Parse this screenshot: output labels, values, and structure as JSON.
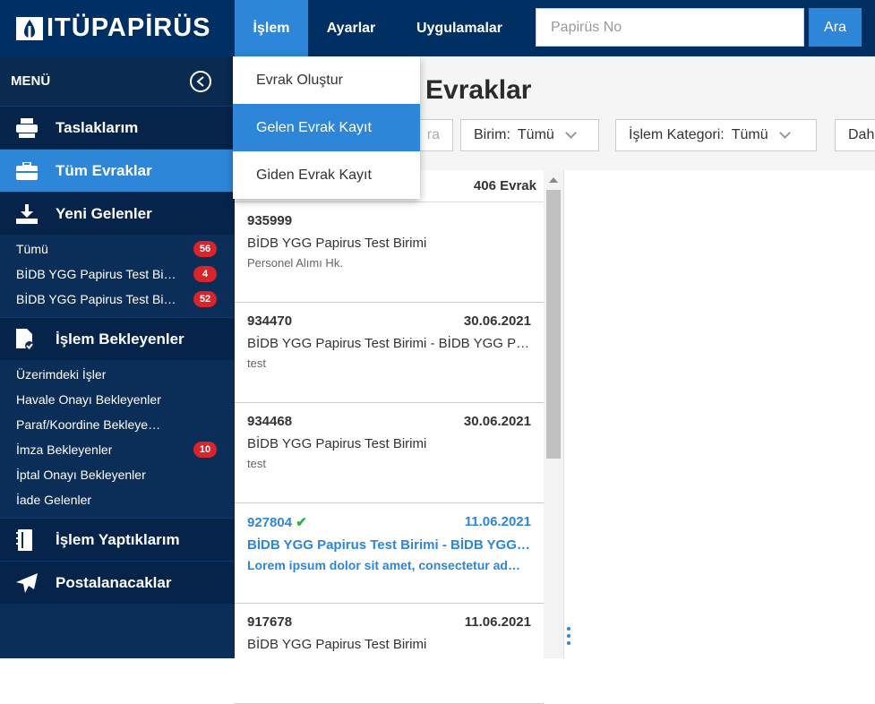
{
  "header": {
    "logo_text": "ITÜPAPİRÜS",
    "nav": [
      {
        "label": "İşlem",
        "active": true
      },
      {
        "label": "Ayarlar",
        "active": false
      },
      {
        "label": "Uygulamalar",
        "active": false
      }
    ],
    "search_placeholder": "Papirüs No",
    "search_button": "Ara"
  },
  "sidebar": {
    "menu_label": "MENÜ",
    "sections": [
      {
        "label": "Taslaklarım",
        "icon": "printer-icon"
      },
      {
        "label": "Tüm Evraklar",
        "icon": "briefcase-icon",
        "active": true
      },
      {
        "label": "Yeni Gelenler",
        "icon": "download-icon"
      },
      {
        "label": "İşlem Bekleyenler",
        "icon": "document-check-icon"
      },
      {
        "label": "İşlem Yaptıklarım",
        "icon": "notebook-icon"
      },
      {
        "label": "Postalanacaklar",
        "icon": "paper-plane-icon"
      }
    ],
    "yeni_gelenler_items": [
      {
        "label": "Tümü",
        "badge": "56"
      },
      {
        "label": "BİDB YGG Papirus Test Bi…",
        "badge": "4"
      },
      {
        "label": "BİDB YGG Papirus Test Bi…",
        "badge": "52"
      }
    ],
    "islem_bekleyenler_items": [
      {
        "label": "Üzerimdeki İşler",
        "badge": ""
      },
      {
        "label": "Havale Onayı Bekleyenler",
        "badge": ""
      },
      {
        "label": "Paraf/Koordine Bekleye…",
        "badge": ""
      },
      {
        "label": "İmza Bekleyenler",
        "badge": "10"
      },
      {
        "label": "İptal Onayı Bekleyenler",
        "badge": ""
      },
      {
        "label": "İade Gelenler",
        "badge": ""
      }
    ]
  },
  "page": {
    "title": "Tüm Evraklar",
    "title_visible": "m Evraklar",
    "filters": {
      "search_partial": "ra",
      "birim_label": "Birim:",
      "birim_value": "Tümü",
      "kategori_label": "İşlem Kategori:",
      "kategori_value": "Tümü",
      "more_partial": "Dah"
    }
  },
  "list": {
    "count_label": "406 Evrak",
    "items": [
      {
        "no": "935999",
        "date": "",
        "unit": "BİDB YGG Papirus Test Birimi",
        "subject": "Personel Alımı Hk.",
        "unread": false
      },
      {
        "no": "934470",
        "date": "30.06.2021",
        "unit": "BİDB YGG Papirus Test Birimi - BİDB YGG P…",
        "subject": "test",
        "unread": false
      },
      {
        "no": "934468",
        "date": "30.06.2021",
        "unit": "BİDB YGG Papirus Test Birimi",
        "subject": "test",
        "unread": false
      },
      {
        "no": "927804",
        "date": "11.06.2021",
        "unit": "BİDB YGG Papirus Test Birimi - BİDB YGG …",
        "subject": "Lorem ipsum dolor sit amet, consectetur ad…",
        "unread": true
      },
      {
        "no": "917678",
        "date": "11.06.2021",
        "unit": "BİDB YGG Papirus Test Birimi",
        "subject": "",
        "unread": false
      }
    ]
  },
  "dropdown": {
    "items": [
      {
        "label": "Evrak Oluştur",
        "selected": false
      },
      {
        "label": "Gelen Evrak Kayıt",
        "selected": true
      },
      {
        "label": "Giden Evrak Kayıt",
        "selected": false
      }
    ]
  },
  "colors": {
    "navy": "#003063",
    "accent": "#2d86d8",
    "badge": "#d8242a",
    "check": "#2bb04a"
  }
}
